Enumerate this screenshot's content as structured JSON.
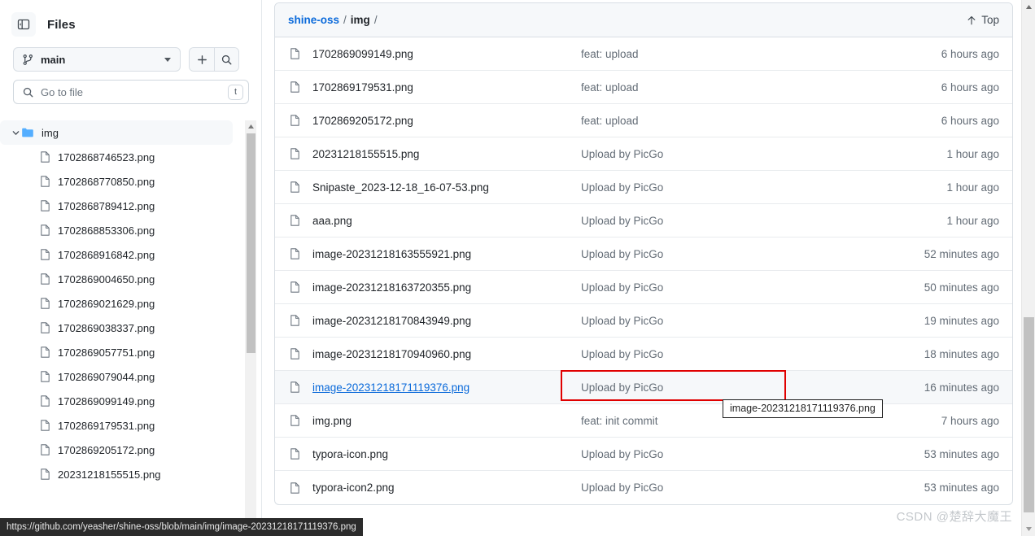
{
  "sidebar": {
    "title": "Files",
    "collapse_icon": "sidebar-collapse-icon",
    "branch": {
      "icon": "git-branch-icon",
      "name": "main",
      "caret_icon": "caret-down-icon",
      "add_icon": "plus-icon",
      "search_icon": "search-icon"
    },
    "gotofile": {
      "icon": "search-icon",
      "placeholder": "Go to file",
      "value": "",
      "shortcut": "t"
    },
    "tree": [
      {
        "type": "folder",
        "label": "img",
        "expanded": true,
        "selected": true
      },
      {
        "type": "file",
        "label": "1702868746523.png"
      },
      {
        "type": "file",
        "label": "1702868770850.png"
      },
      {
        "type": "file",
        "label": "1702868789412.png"
      },
      {
        "type": "file",
        "label": "1702868853306.png"
      },
      {
        "type": "file",
        "label": "1702868916842.png"
      },
      {
        "type": "file",
        "label": "1702869004650.png"
      },
      {
        "type": "file",
        "label": "1702869021629.png"
      },
      {
        "type": "file",
        "label": "1702869038337.png"
      },
      {
        "type": "file",
        "label": "1702869057751.png"
      },
      {
        "type": "file",
        "label": "1702869079044.png"
      },
      {
        "type": "file",
        "label": "1702869099149.png"
      },
      {
        "type": "file",
        "label": "1702869179531.png"
      },
      {
        "type": "file",
        "label": "1702869205172.png"
      },
      {
        "type": "file",
        "label": "20231218155515.png"
      }
    ]
  },
  "main": {
    "breadcrumb": {
      "repo": "shine-oss",
      "sep1": "/",
      "folder": "img",
      "sep2": "/"
    },
    "top_button": {
      "icon": "arrow-up-icon",
      "label": "Top"
    },
    "rows": [
      {
        "name": "1702869099149.png",
        "message": "feat: upload",
        "time": "6 hours ago"
      },
      {
        "name": "1702869179531.png",
        "message": "feat: upload",
        "time": "6 hours ago"
      },
      {
        "name": "1702869205172.png",
        "message": "feat: upload",
        "time": "6 hours ago"
      },
      {
        "name": "20231218155515.png",
        "message": "Upload by PicGo",
        "time": "1 hour ago"
      },
      {
        "name": "Snipaste_2023-12-18_16-07-53.png",
        "message": "Upload by PicGo",
        "time": "1 hour ago"
      },
      {
        "name": "aaa.png",
        "message": "Upload by PicGo",
        "time": "1 hour ago"
      },
      {
        "name": "image-20231218163555921.png",
        "message": "Upload by PicGo",
        "time": "52 minutes ago"
      },
      {
        "name": "image-20231218163720355.png",
        "message": "Upload by PicGo",
        "time": "50 minutes ago"
      },
      {
        "name": "image-20231218170843949.png",
        "message": "Upload by PicGo",
        "time": "19 minutes ago"
      },
      {
        "name": "image-20231218170940960.png",
        "message": "Upload by PicGo",
        "time": "18 minutes ago"
      },
      {
        "name": "image-20231218171119376.png",
        "message": "Upload by PicGo",
        "time": "16 minutes ago",
        "highlighted": true,
        "link": true
      },
      {
        "name": "img.png",
        "message": "feat: init commit",
        "time": "7 hours ago"
      },
      {
        "name": "typora-icon.png",
        "message": "Upload by PicGo",
        "time": "53 minutes ago"
      },
      {
        "name": "typora-icon2.png",
        "message": "Upload by PicGo",
        "time": "53 minutes ago"
      }
    ]
  },
  "tooltip": {
    "text": "image-20231218171119376.png"
  },
  "statusbar": {
    "url": "https://github.com/yeasher/shine-oss/blob/main/img/image-20231218171119376.png"
  },
  "watermark": {
    "text": "CSDN @楚辞大魔王"
  },
  "scrollbars": {
    "sidebar_arrow_up": "triangle-up-icon",
    "window_arrow_up": "triangle-up-icon",
    "window_arrow_down": "triangle-down-icon"
  },
  "colors": {
    "link": "#0969da",
    "accent": "#0969da",
    "annotation": "#e00000",
    "muted": "#636c76",
    "panel_header": "#f6f8fa"
  }
}
